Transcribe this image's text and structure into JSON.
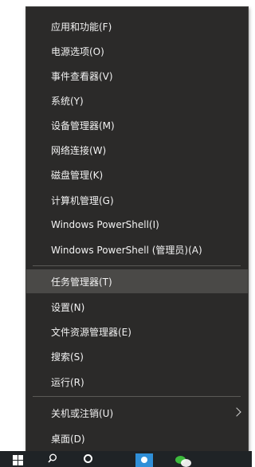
{
  "menu": {
    "items": [
      {
        "label": "应用和功能(F)"
      },
      {
        "label": "电源选项(O)"
      },
      {
        "label": "事件查看器(V)"
      },
      {
        "label": "系统(Y)"
      },
      {
        "label": "设备管理器(M)"
      },
      {
        "label": "网络连接(W)"
      },
      {
        "label": "磁盘管理(K)"
      },
      {
        "label": "计算机管理(G)"
      },
      {
        "label": "Windows PowerShell(I)"
      },
      {
        "label": "Windows PowerShell (管理员)(A)"
      },
      {
        "label": "任务管理器(T)",
        "state": "hover"
      },
      {
        "label": "设置(N)"
      },
      {
        "label": "文件资源管理器(E)"
      },
      {
        "label": "搜索(S)"
      },
      {
        "label": "运行(R)"
      },
      {
        "label": "关机或注销(U)",
        "has_submenu": true
      },
      {
        "label": "桌面(D)"
      }
    ]
  },
  "taskbar": {
    "icons": [
      "windows-start-icon",
      "search-icon",
      "task-view-icon",
      "pinned-app-icon",
      "wechat-icon"
    ]
  },
  "colors": {
    "menu_background": "#2b2a29",
    "menu_text": "#f2f2f2",
    "hover_background": "#4a4947",
    "separator": "#5a5956",
    "taskbar": "#1f2326"
  }
}
